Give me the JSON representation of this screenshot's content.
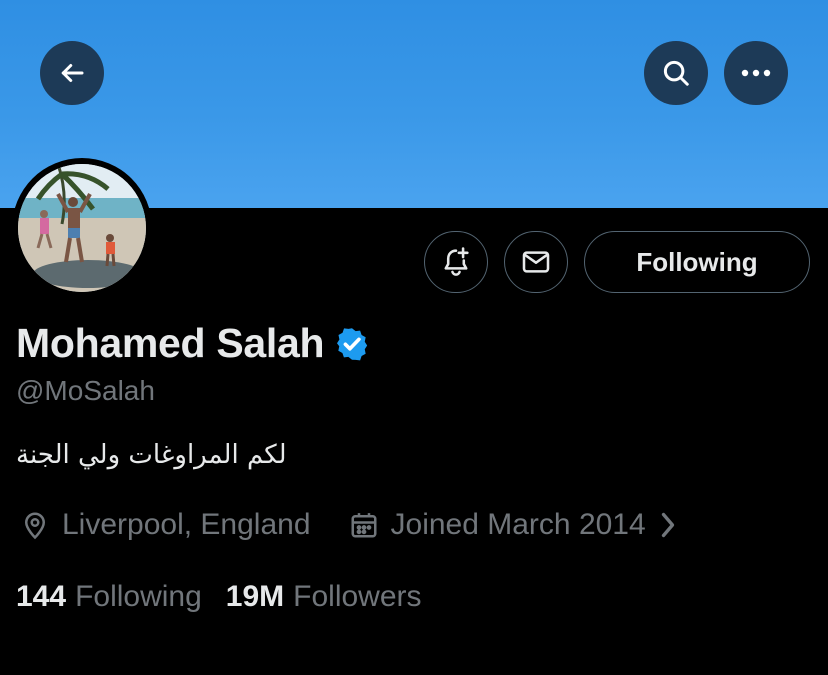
{
  "profile": {
    "name": "Mohamed Salah",
    "handle": "@MoSalah",
    "bio": "لكم المراوغات ولي الجنة",
    "location": "Liverpool, England",
    "joined": "Joined March 2014",
    "following_count": "144",
    "following_label": "Following",
    "followers_count": "19M",
    "followers_label": "Followers"
  },
  "actions": {
    "follow_state": "Following"
  },
  "colors": {
    "verified": "#1d9bf0",
    "banner": "#3a98e8",
    "background": "#000000",
    "secondary_text": "#71767b"
  },
  "icons": [
    "back-arrow-icon",
    "search-icon",
    "more-icon",
    "bell-plus-icon",
    "mail-icon",
    "verified-badge-icon",
    "location-pin-icon",
    "calendar-icon",
    "chevron-right-icon"
  ]
}
